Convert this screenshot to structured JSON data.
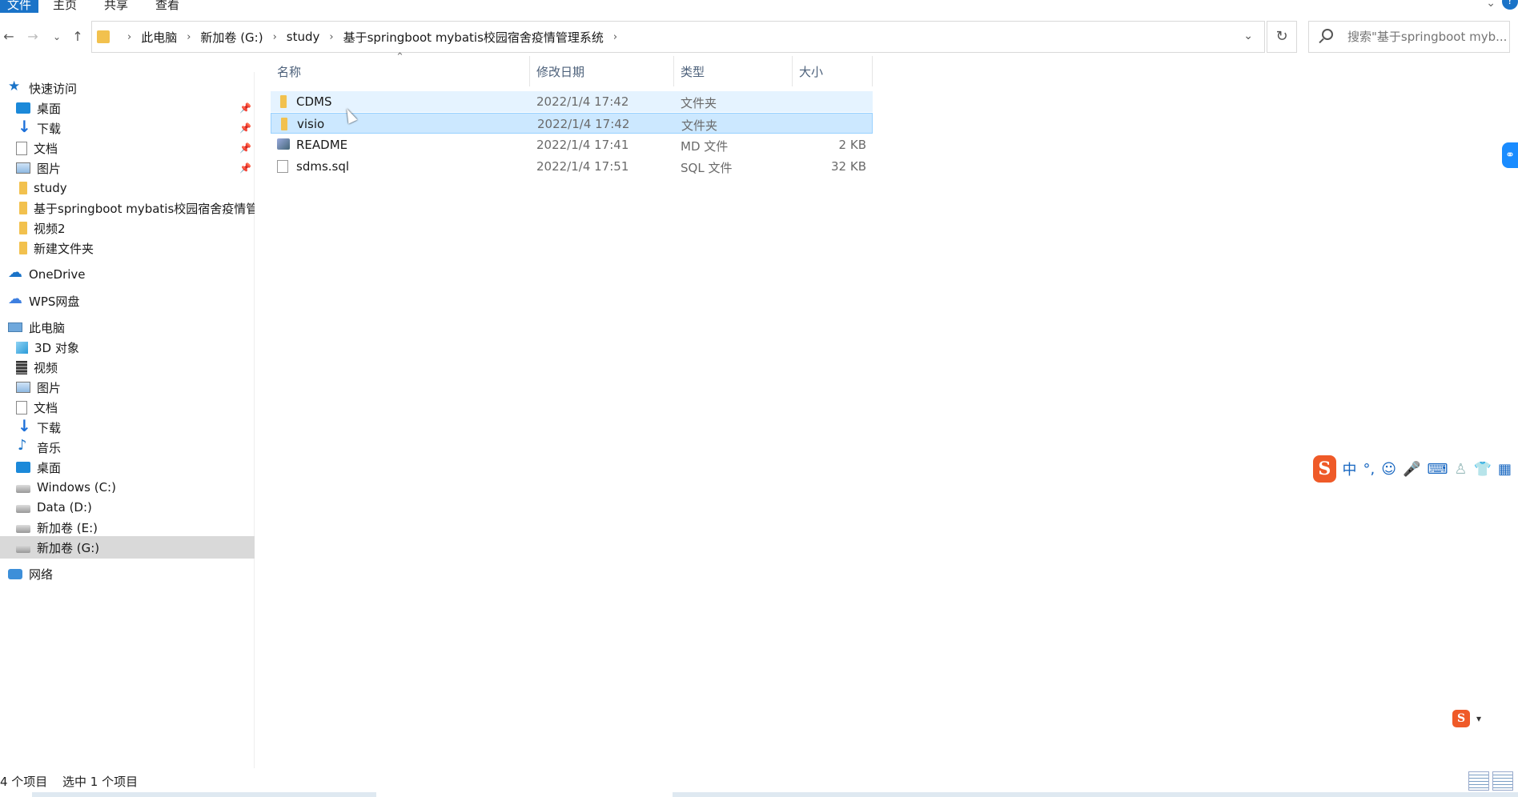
{
  "ribbon": {
    "tabs": [
      "文件",
      "主页",
      "共享",
      "查看"
    ]
  },
  "address": {
    "crumbs": [
      "此电脑",
      "新加卷 (G:)",
      "study",
      "基于springboot mybatis校园宿舍疫情管理系统"
    ]
  },
  "search": {
    "placeholder": "搜索\"基于springboot myb..."
  },
  "sidebar": {
    "quick_access": "快速访问",
    "quick_items": [
      {
        "label": "桌面",
        "icon": "desktop-icon",
        "pinned": true
      },
      {
        "label": "下载",
        "icon": "download-icon",
        "pinned": true
      },
      {
        "label": "文档",
        "icon": "document-icon",
        "pinned": true
      },
      {
        "label": "图片",
        "icon": "pictures-icon",
        "pinned": true
      },
      {
        "label": "study",
        "icon": "folder-icon",
        "pinned": false
      },
      {
        "label": "基于springboot mybatis校园宿舍疫情管",
        "icon": "folder-icon",
        "pinned": false
      },
      {
        "label": "视频2",
        "icon": "folder-icon",
        "pinned": false
      },
      {
        "label": "新建文件夹",
        "icon": "folder-icon",
        "pinned": false
      }
    ],
    "onedrive": "OneDrive",
    "wps": "WPS网盘",
    "this_pc": "此电脑",
    "pc_items": [
      {
        "label": "3D 对象",
        "icon": "3d-objects-icon"
      },
      {
        "label": "视频",
        "icon": "video-icon"
      },
      {
        "label": "图片",
        "icon": "pictures-icon"
      },
      {
        "label": "文档",
        "icon": "document-icon"
      },
      {
        "label": "下载",
        "icon": "download-icon"
      },
      {
        "label": "音乐",
        "icon": "music-icon"
      },
      {
        "label": "桌面",
        "icon": "desktop-icon"
      },
      {
        "label": "Windows (C:)",
        "icon": "drive-icon"
      },
      {
        "label": "Data (D:)",
        "icon": "drive-icon"
      },
      {
        "label": "新加卷 (E:)",
        "icon": "drive-icon"
      },
      {
        "label": "新加卷 (G:)",
        "icon": "drive-icon",
        "selected": true
      }
    ],
    "network": "网络"
  },
  "columns": {
    "name": "名称",
    "date": "修改日期",
    "type": "类型",
    "size": "大小"
  },
  "files": [
    {
      "name": "CDMS",
      "date": "2022/1/4 17:42",
      "type": "文件夹",
      "size": "",
      "icon": "folder-icon",
      "state": "hover"
    },
    {
      "name": "visio",
      "date": "2022/1/4 17:42",
      "type": "文件夹",
      "size": "",
      "icon": "folder-icon",
      "state": "selected"
    },
    {
      "name": "README",
      "date": "2022/1/4 17:41",
      "type": "MD 文件",
      "size": "2 KB",
      "icon": "markdown-file-icon",
      "state": ""
    },
    {
      "name": "sdms.sql",
      "date": "2022/1/4 17:51",
      "type": "SQL 文件",
      "size": "32 KB",
      "icon": "file-icon",
      "state": ""
    }
  ],
  "ime": {
    "logo": "S",
    "lang": "中",
    "punct": "°,"
  },
  "status": {
    "count": "4 个项目",
    "selected": "选中 1 个项目"
  },
  "colors": {
    "accent": "#1a73c8",
    "selection": "#cce8ff",
    "hover": "#e5f3ff",
    "folder": "#f2c14e",
    "ime": "#ef5a28"
  }
}
